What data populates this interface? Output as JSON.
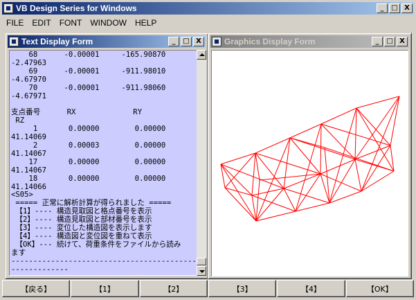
{
  "app": {
    "title": "VB Design Series for Windows",
    "window_buttons": {
      "minimize": "_",
      "maximize": "□",
      "close": "X"
    }
  },
  "menu": [
    "FILE",
    "EDIT",
    "FONT",
    "WINDOW",
    "HELP"
  ],
  "text_window": {
    "title": "Text Display Form",
    "content": "    68      -0.00001     -165.90870\n-2.47963\n    69      -0.00001     -911.98010\n-4.67970\n    70      -0.00001     -911.98060\n-4.67971\n\n支点番号      RX             RY\n RZ\n     1       0.00000        0.00000\n41.14069\n     2       0.00003        0.00000\n41.14067\n    17       0.00000        0.00000\n41.14067\n    18       0.00000        0.00000\n41.14066\n<S05>\n ===== 正常に解析計算が得られました =====\n 【1】---- 構造見取図と格点番号を表示\n 【2】---- 構造見取図と部材番号を表示\n 【3】---- 変位した構造図を表示します\n 【4】---- 構造図と変位図を重ねて表示\n 【OK】--- 続けて、荷重条件をファイルから読み\nます\n-------------------------------------------\n-------------"
  },
  "graphics_window": {
    "title": "Graphics Display Form",
    "line_color": "#ff0000"
  },
  "toolbar": {
    "buttons": [
      "【戻る】",
      "【1】",
      "【2】",
      "【3】",
      "【4】",
      "【OK】"
    ]
  },
  "colors": {
    "title_active": "#0a246a",
    "text_background": "#ccccff",
    "structure_line": "#ff0000"
  }
}
